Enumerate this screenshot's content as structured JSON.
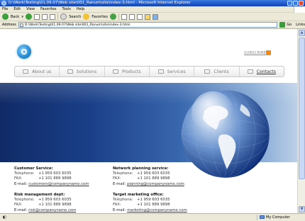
{
  "window": {
    "title": "D:\\Work\\Testing\\01.09.07\\Web site\\001_Ranum\\site\\index-3.html - Microsoft Internet Explorer"
  },
  "menubar": {
    "items": [
      "File",
      "Edit",
      "View",
      "Favorites",
      "Tools",
      "Help"
    ]
  },
  "toolbar": {
    "back_label": "Back",
    "search_label": "Search",
    "favorites_label": "Favorites"
  },
  "addressbar": {
    "label": "Address",
    "url": "D:\\Work\\Testing\\01.09.07\\Web site\\001_Ranum\\site\\index-3.html",
    "go_label": "Go",
    "links_label": "Links"
  },
  "site": {
    "subscribe": "SUBSCRIBE",
    "nav": [
      "About us",
      "Solutions",
      "Products",
      "Services",
      "Clients",
      "Contacts"
    ],
    "active_nav": "Contacts",
    "contacts": [
      {
        "head": "Customer Service:",
        "telephone_label": "Telephone:",
        "telephone": "+1 959 603 6035",
        "fax_label": "FAX:",
        "fax": "+1 101 889 9898",
        "email_label": "E-mail:",
        "email": "customers@companyname.com"
      },
      {
        "head": "Network planning service:",
        "telephone_label": "Telephone:",
        "telephone": "+1 959 603 6035",
        "fax_label": "FAX:",
        "fax": "+1 101 889 9898",
        "email_label": "E-mail:",
        "email": "planning@companyname.com"
      },
      {
        "head": "Risk management dept:",
        "telephone_label": "Telephone:",
        "telephone": "+1 959 603 6035",
        "fax_label": "FAX:",
        "fax": "+1 101 889 9898",
        "email_label": "E-mail:",
        "email": "risk@companyname.com"
      },
      {
        "head": "Target marketing office:",
        "telephone_label": "Telephone:",
        "telephone": "+1 959 603 6035",
        "fax_label": "FAX:",
        "fax": "+1 101 889 9898",
        "email_label": "E-mail:",
        "email": "marketing@companyname.com"
      }
    ]
  },
  "statusbar": {
    "zone": "My Computer"
  },
  "colors": {
    "hero_dark": "#102a66",
    "hero_light": "#bcd0e8",
    "accent": "#2a8fd5"
  }
}
